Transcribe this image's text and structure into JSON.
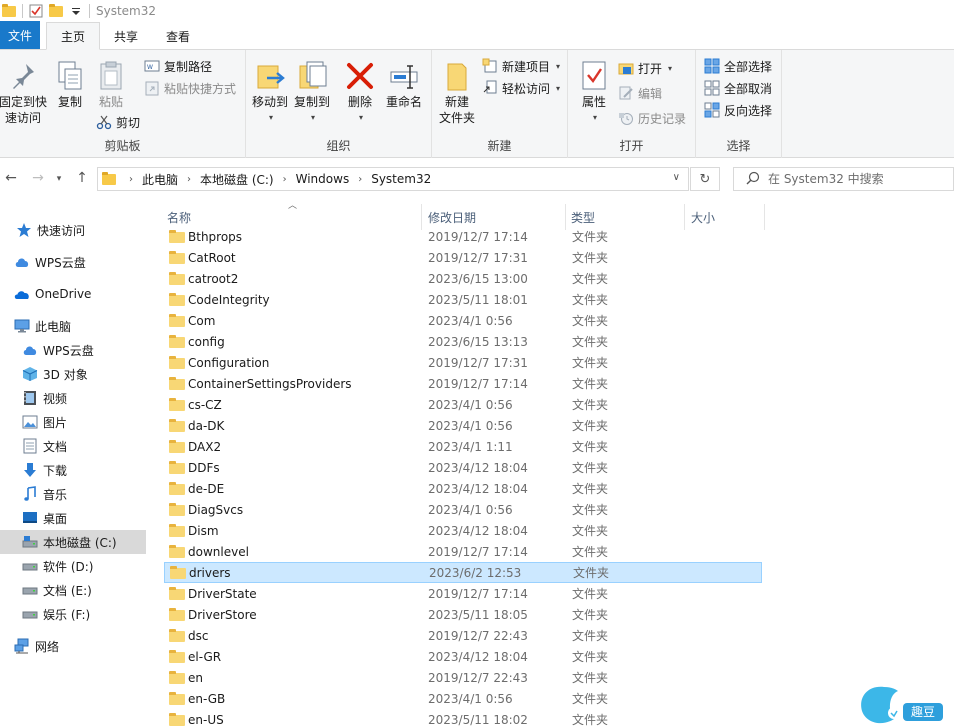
{
  "window": {
    "title": "System32"
  },
  "ribbon_tabs": [
    {
      "label": "文件"
    },
    {
      "label": "主页"
    },
    {
      "label": "共享"
    },
    {
      "label": "查看"
    }
  ],
  "ribbon": {
    "clipboard": {
      "label": "剪贴板",
      "pin": "固定到快\n速访问",
      "copy": "复制",
      "paste": "粘贴",
      "copy_path": "复制路径",
      "paste_shortcut": "粘贴快捷方式",
      "cut": "剪切"
    },
    "organize": {
      "label": "组织",
      "move_to": "移动到",
      "copy_to": "复制到",
      "delete": "删除",
      "rename": "重命名"
    },
    "new": {
      "label": "新建",
      "new_folder": "新建\n文件夹",
      "new_item": "新建项目",
      "easy_access": "轻松访问"
    },
    "open": {
      "label": "打开",
      "properties": "属性",
      "open": "打开",
      "edit": "编辑",
      "history": "历史记录"
    },
    "select": {
      "label": "选择",
      "select_all": "全部选择",
      "select_none": "全部取消",
      "invert": "反向选择"
    }
  },
  "address": {
    "crumbs": [
      "此电脑",
      "本地磁盘 (C:)",
      "Windows",
      "System32"
    ]
  },
  "search": {
    "placeholder": "在 System32 中搜索"
  },
  "sidebar": {
    "items": [
      {
        "label": "快速访问",
        "icon": "star-icon"
      },
      {
        "label": "WPS云盘",
        "icon": "cloud-icon"
      },
      {
        "label": "OneDrive",
        "icon": "onedrive-icon"
      },
      {
        "label": "此电脑",
        "icon": "pc-icon"
      },
      {
        "label": "WPS云盘",
        "icon": "cloud-icon"
      },
      {
        "label": "3D 对象",
        "icon": "cube-icon"
      },
      {
        "label": "视频",
        "icon": "video-icon"
      },
      {
        "label": "图片",
        "icon": "picture-icon"
      },
      {
        "label": "文档",
        "icon": "document-icon"
      },
      {
        "label": "下载",
        "icon": "download-icon"
      },
      {
        "label": "音乐",
        "icon": "music-icon"
      },
      {
        "label": "桌面",
        "icon": "desktop-icon"
      },
      {
        "label": "本地磁盘 (C:)",
        "icon": "drive-icon"
      },
      {
        "label": "软件 (D:)",
        "icon": "drive-icon"
      },
      {
        "label": "文档 (E:)",
        "icon": "drive-icon"
      },
      {
        "label": "娱乐 (F:)",
        "icon": "drive-icon"
      },
      {
        "label": "网络",
        "icon": "network-icon"
      }
    ]
  },
  "columns": {
    "name": "名称",
    "date": "修改日期",
    "type": "类型",
    "size": "大小"
  },
  "files": [
    {
      "name": "Bthprops",
      "date": "2019/12/7 17:14",
      "type": "文件夹"
    },
    {
      "name": "CatRoot",
      "date": "2019/12/7 17:31",
      "type": "文件夹"
    },
    {
      "name": "catroot2",
      "date": "2023/6/15 13:00",
      "type": "文件夹"
    },
    {
      "name": "CodeIntegrity",
      "date": "2023/5/11 18:01",
      "type": "文件夹"
    },
    {
      "name": "Com",
      "date": "2023/4/1 0:56",
      "type": "文件夹"
    },
    {
      "name": "config",
      "date": "2023/6/15 13:13",
      "type": "文件夹"
    },
    {
      "name": "Configuration",
      "date": "2019/12/7 17:31",
      "type": "文件夹"
    },
    {
      "name": "ContainerSettingsProviders",
      "date": "2019/12/7 17:14",
      "type": "文件夹"
    },
    {
      "name": "cs-CZ",
      "date": "2023/4/1 0:56",
      "type": "文件夹"
    },
    {
      "name": "da-DK",
      "date": "2023/4/1 0:56",
      "type": "文件夹"
    },
    {
      "name": "DAX2",
      "date": "2023/4/1 1:11",
      "type": "文件夹"
    },
    {
      "name": "DDFs",
      "date": "2023/4/12 18:04",
      "type": "文件夹"
    },
    {
      "name": "de-DE",
      "date": "2023/4/12 18:04",
      "type": "文件夹"
    },
    {
      "name": "DiagSvcs",
      "date": "2023/4/1 0:56",
      "type": "文件夹"
    },
    {
      "name": "Dism",
      "date": "2023/4/12 18:04",
      "type": "文件夹"
    },
    {
      "name": "downlevel",
      "date": "2019/12/7 17:14",
      "type": "文件夹"
    },
    {
      "name": "drivers",
      "date": "2023/6/2 12:53",
      "type": "文件夹",
      "selected": true
    },
    {
      "name": "DriverState",
      "date": "2019/12/7 17:14",
      "type": "文件夹"
    },
    {
      "name": "DriverStore",
      "date": "2023/5/11 18:05",
      "type": "文件夹"
    },
    {
      "name": "dsc",
      "date": "2019/12/7 22:43",
      "type": "文件夹"
    },
    {
      "name": "el-GR",
      "date": "2023/4/12 18:04",
      "type": "文件夹"
    },
    {
      "name": "en",
      "date": "2019/12/7 22:43",
      "type": "文件夹"
    },
    {
      "name": "en-GB",
      "date": "2023/4/1 0:56",
      "type": "文件夹"
    },
    {
      "name": "en-US",
      "date": "2023/5/11 18:02",
      "type": "文件夹"
    }
  ],
  "watermark": {
    "text": "趣豆"
  },
  "colors": {
    "accent": "#1979ca",
    "selection": "#cce8ff",
    "folder": "#f8d775"
  }
}
